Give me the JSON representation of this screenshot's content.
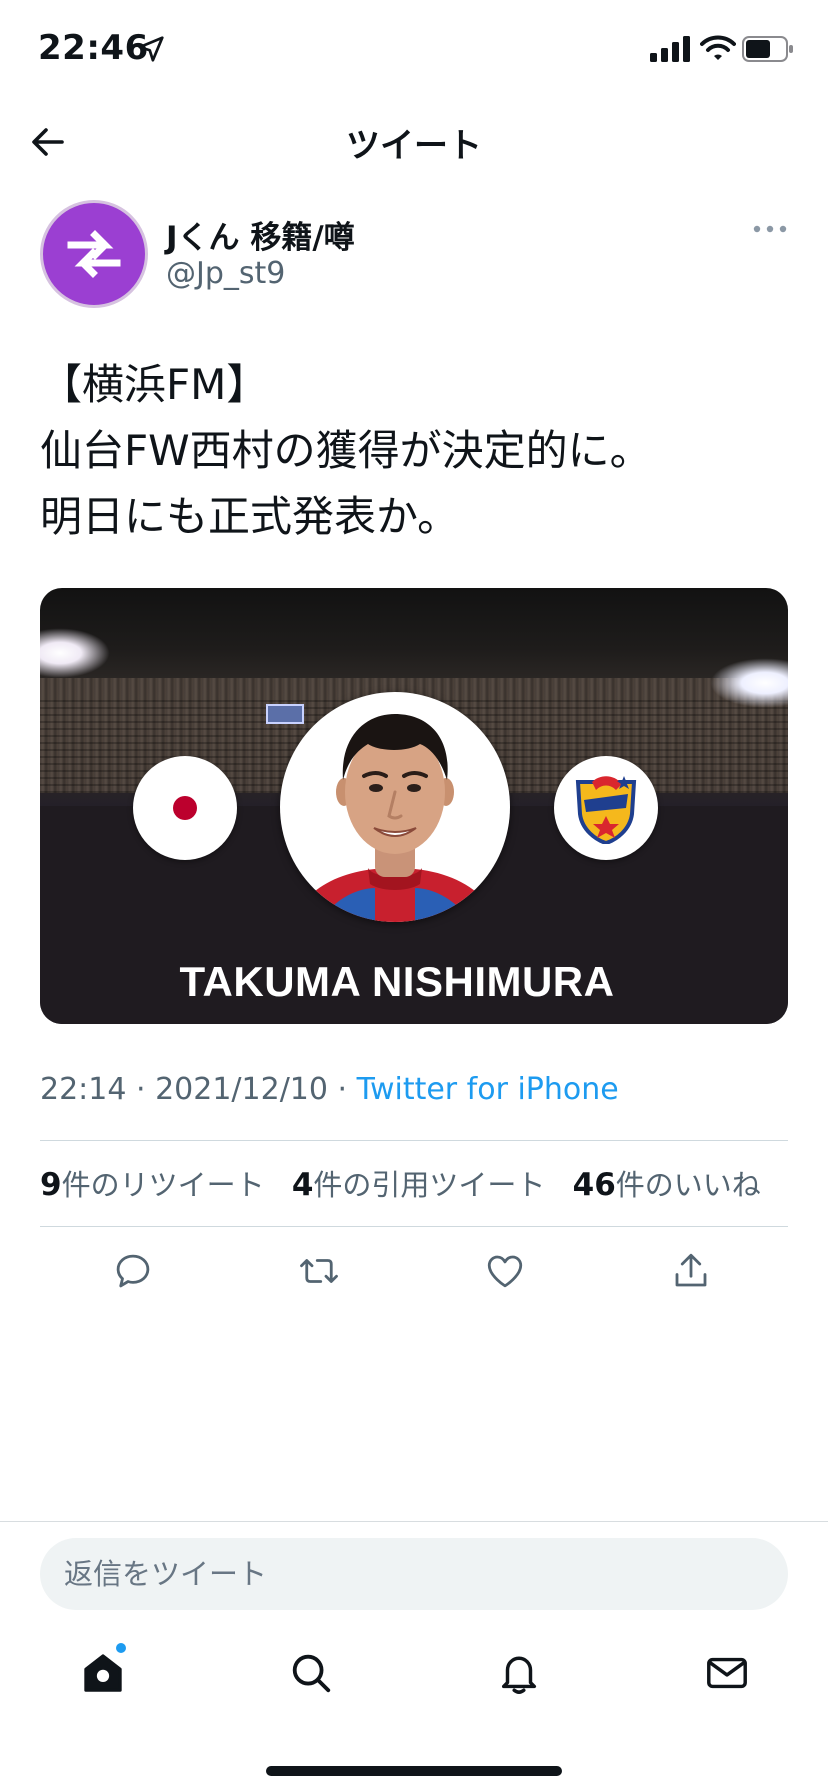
{
  "status_bar": {
    "time": "22:46"
  },
  "header": {
    "title": "ツイート"
  },
  "tweet": {
    "author": {
      "display_name": "Jくん 移籍/噂",
      "handle": "@Jp_st9"
    },
    "text_lines": [
      "【横浜FM】",
      "仙台FW西村の獲得が決定的に。",
      "明日にも正式発表か。"
    ],
    "media": {
      "player_name": "TAKUMA NISHIMURA"
    },
    "timestamp": "22:14 · 2021/12/10 · ",
    "source": "Twitter for iPhone",
    "stats": {
      "retweets_count": "9",
      "retweets_label": "件のリツイート",
      "quotes_count": "4",
      "quotes_label": "件の引用ツイート",
      "likes_count": "46",
      "likes_label": "件のいいね"
    }
  },
  "reply": {
    "placeholder": "返信をツイート"
  },
  "colors": {
    "accent": "#1d9bf0",
    "avatar": "#9b3fd2",
    "text": "#0f1419",
    "secondary": "#536471"
  },
  "icons": [
    "location-arrow-icon",
    "signal-icon",
    "wifi-icon",
    "battery-icon",
    "back-arrow-icon",
    "more-icon",
    "reply-icon",
    "retweet-icon",
    "like-icon",
    "share-icon",
    "home-icon",
    "search-icon",
    "bell-icon",
    "mail-icon"
  ]
}
